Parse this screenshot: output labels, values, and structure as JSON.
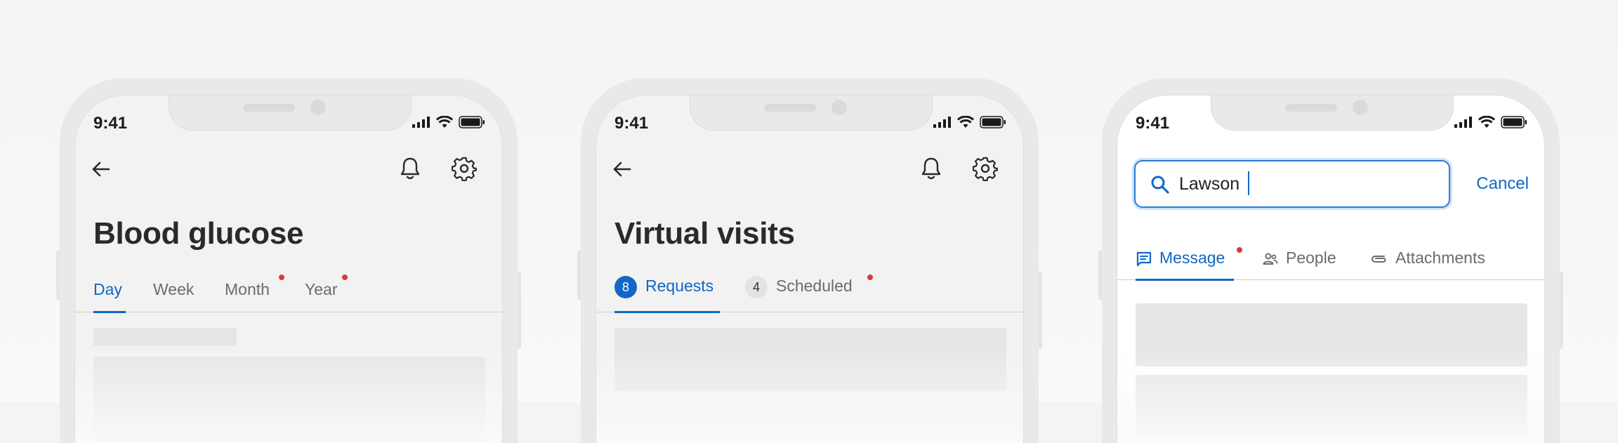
{
  "phones": [
    {
      "status": {
        "time": "9:41"
      },
      "title": "Blood glucose",
      "tabs": [
        {
          "label": "Day"
        },
        {
          "label": "Week"
        },
        {
          "label": "Month"
        },
        {
          "label": "Year"
        }
      ],
      "icons": [
        "back-arrow-icon",
        "bell-icon",
        "gear-icon"
      ]
    },
    {
      "status": {
        "time": "9:41"
      },
      "title": "Virtual visits",
      "tabs": [
        {
          "label": "Requests",
          "count": "8"
        },
        {
          "label": "Scheduled",
          "count": "4"
        }
      ],
      "icons": [
        "back-arrow-icon",
        "bell-icon",
        "gear-icon"
      ]
    },
    {
      "status": {
        "time": "9:41"
      },
      "search": {
        "value": "Lawson"
      },
      "cancel_label": "Cancel",
      "tabs": [
        {
          "label": "Message"
        },
        {
          "label": "People"
        },
        {
          "label": "Attachments"
        }
      ],
      "icons": [
        "search-icon",
        "message-icon",
        "people-icon",
        "attachment-icon"
      ]
    }
  ],
  "colors": {
    "accent": "#0f67c5",
    "badge_dot": "#d63b3b",
    "title_text": "#2a2a2a",
    "inactive_tab": "#6b6b6b"
  }
}
